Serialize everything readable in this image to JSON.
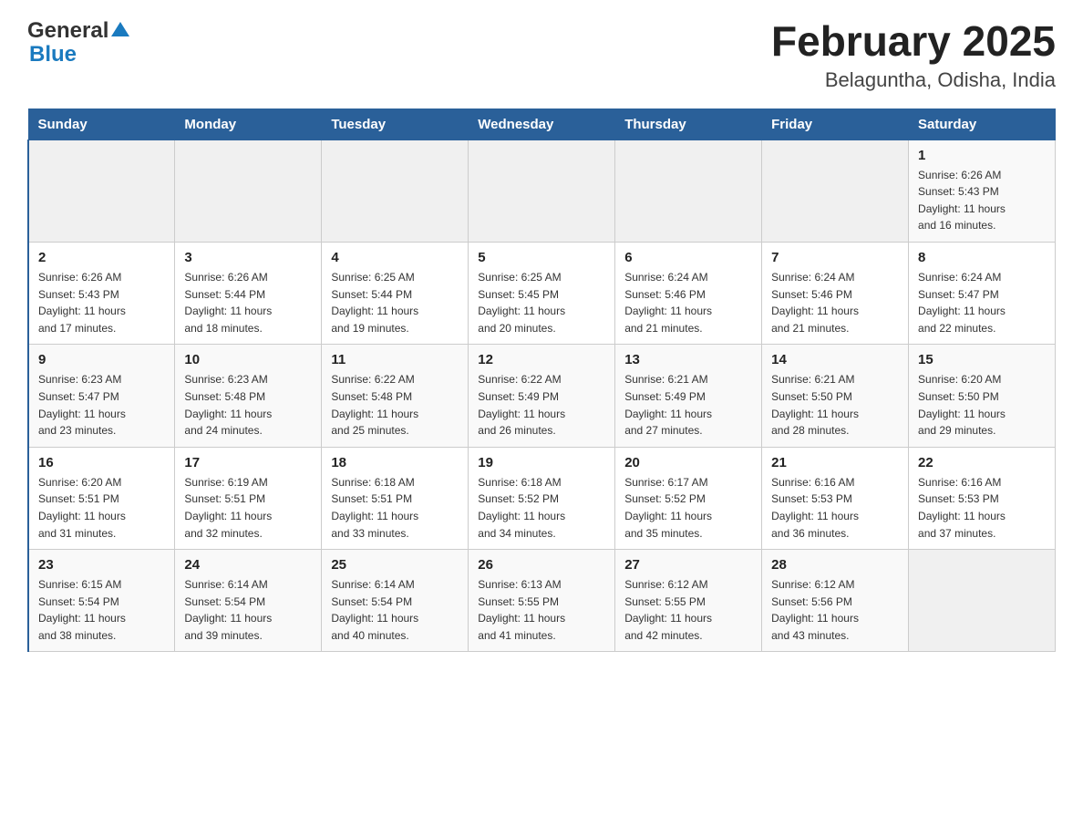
{
  "header": {
    "logo": {
      "general": "General",
      "blue": "Blue",
      "triangle_color": "#1a7abf"
    },
    "title": "February 2025",
    "subtitle": "Belaguntha, Odisha, India"
  },
  "calendar": {
    "days_of_week": [
      "Sunday",
      "Monday",
      "Tuesday",
      "Wednesday",
      "Thursday",
      "Friday",
      "Saturday"
    ],
    "weeks": [
      [
        {
          "day": "",
          "info": ""
        },
        {
          "day": "",
          "info": ""
        },
        {
          "day": "",
          "info": ""
        },
        {
          "day": "",
          "info": ""
        },
        {
          "day": "",
          "info": ""
        },
        {
          "day": "",
          "info": ""
        },
        {
          "day": "1",
          "info": "Sunrise: 6:26 AM\nSunset: 5:43 PM\nDaylight: 11 hours\nand 16 minutes."
        }
      ],
      [
        {
          "day": "2",
          "info": "Sunrise: 6:26 AM\nSunset: 5:43 PM\nDaylight: 11 hours\nand 17 minutes."
        },
        {
          "day": "3",
          "info": "Sunrise: 6:26 AM\nSunset: 5:44 PM\nDaylight: 11 hours\nand 18 minutes."
        },
        {
          "day": "4",
          "info": "Sunrise: 6:25 AM\nSunset: 5:44 PM\nDaylight: 11 hours\nand 19 minutes."
        },
        {
          "day": "5",
          "info": "Sunrise: 6:25 AM\nSunset: 5:45 PM\nDaylight: 11 hours\nand 20 minutes."
        },
        {
          "day": "6",
          "info": "Sunrise: 6:24 AM\nSunset: 5:46 PM\nDaylight: 11 hours\nand 21 minutes."
        },
        {
          "day": "7",
          "info": "Sunrise: 6:24 AM\nSunset: 5:46 PM\nDaylight: 11 hours\nand 21 minutes."
        },
        {
          "day": "8",
          "info": "Sunrise: 6:24 AM\nSunset: 5:47 PM\nDaylight: 11 hours\nand 22 minutes."
        }
      ],
      [
        {
          "day": "9",
          "info": "Sunrise: 6:23 AM\nSunset: 5:47 PM\nDaylight: 11 hours\nand 23 minutes."
        },
        {
          "day": "10",
          "info": "Sunrise: 6:23 AM\nSunset: 5:48 PM\nDaylight: 11 hours\nand 24 minutes."
        },
        {
          "day": "11",
          "info": "Sunrise: 6:22 AM\nSunset: 5:48 PM\nDaylight: 11 hours\nand 25 minutes."
        },
        {
          "day": "12",
          "info": "Sunrise: 6:22 AM\nSunset: 5:49 PM\nDaylight: 11 hours\nand 26 minutes."
        },
        {
          "day": "13",
          "info": "Sunrise: 6:21 AM\nSunset: 5:49 PM\nDaylight: 11 hours\nand 27 minutes."
        },
        {
          "day": "14",
          "info": "Sunrise: 6:21 AM\nSunset: 5:50 PM\nDaylight: 11 hours\nand 28 minutes."
        },
        {
          "day": "15",
          "info": "Sunrise: 6:20 AM\nSunset: 5:50 PM\nDaylight: 11 hours\nand 29 minutes."
        }
      ],
      [
        {
          "day": "16",
          "info": "Sunrise: 6:20 AM\nSunset: 5:51 PM\nDaylight: 11 hours\nand 31 minutes."
        },
        {
          "day": "17",
          "info": "Sunrise: 6:19 AM\nSunset: 5:51 PM\nDaylight: 11 hours\nand 32 minutes."
        },
        {
          "day": "18",
          "info": "Sunrise: 6:18 AM\nSunset: 5:51 PM\nDaylight: 11 hours\nand 33 minutes."
        },
        {
          "day": "19",
          "info": "Sunrise: 6:18 AM\nSunset: 5:52 PM\nDaylight: 11 hours\nand 34 minutes."
        },
        {
          "day": "20",
          "info": "Sunrise: 6:17 AM\nSunset: 5:52 PM\nDaylight: 11 hours\nand 35 minutes."
        },
        {
          "day": "21",
          "info": "Sunrise: 6:16 AM\nSunset: 5:53 PM\nDaylight: 11 hours\nand 36 minutes."
        },
        {
          "day": "22",
          "info": "Sunrise: 6:16 AM\nSunset: 5:53 PM\nDaylight: 11 hours\nand 37 minutes."
        }
      ],
      [
        {
          "day": "23",
          "info": "Sunrise: 6:15 AM\nSunset: 5:54 PM\nDaylight: 11 hours\nand 38 minutes."
        },
        {
          "day": "24",
          "info": "Sunrise: 6:14 AM\nSunset: 5:54 PM\nDaylight: 11 hours\nand 39 minutes."
        },
        {
          "day": "25",
          "info": "Sunrise: 6:14 AM\nSunset: 5:54 PM\nDaylight: 11 hours\nand 40 minutes."
        },
        {
          "day": "26",
          "info": "Sunrise: 6:13 AM\nSunset: 5:55 PM\nDaylight: 11 hours\nand 41 minutes."
        },
        {
          "day": "27",
          "info": "Sunrise: 6:12 AM\nSunset: 5:55 PM\nDaylight: 11 hours\nand 42 minutes."
        },
        {
          "day": "28",
          "info": "Sunrise: 6:12 AM\nSunset: 5:56 PM\nDaylight: 11 hours\nand 43 minutes."
        },
        {
          "day": "",
          "info": ""
        }
      ]
    ]
  }
}
